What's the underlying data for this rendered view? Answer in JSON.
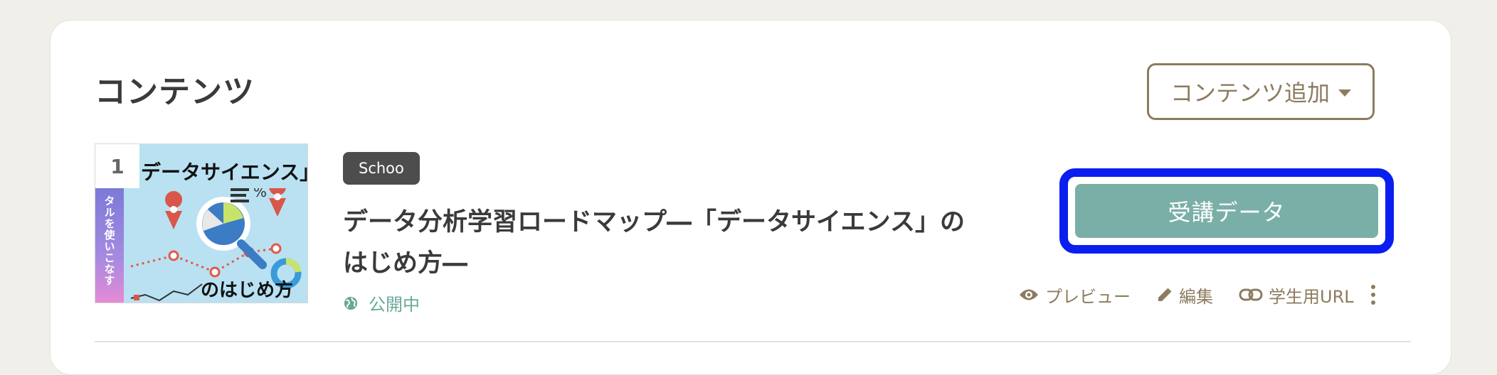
{
  "section": {
    "title": "コンテンツ",
    "add_button_label": "コンテンツ追加"
  },
  "course": {
    "number": "1",
    "thumbnail_heading": "データサイエンス」",
    "thumbnail_side_text": "タルを使いこなす",
    "thumbnail_footer": "のはじめ方",
    "badge": "Schoo",
    "title": "データ分析学習ロードマップ―「データサイエンス」のはじめ方―",
    "status": "公開中",
    "data_button_label": "受講データ",
    "actions": {
      "preview": "プレビュー",
      "edit": "編集",
      "student_url": "学生用URL"
    }
  },
  "colors": {
    "accent_brown": "#8c7b5f",
    "teal_button": "#7aafa7",
    "highlight_blue": "#0a1ef0",
    "status_green": "#6aa89a"
  }
}
